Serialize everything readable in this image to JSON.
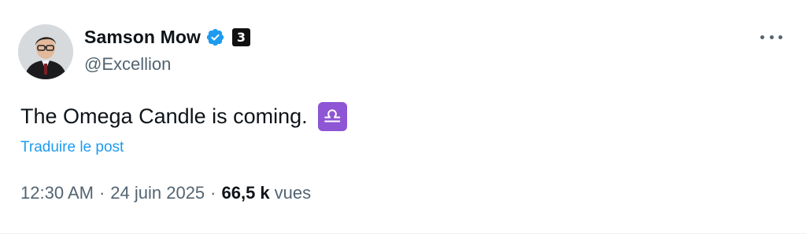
{
  "author": {
    "display_name": "Samson Mow",
    "handle": "@Excellion",
    "verified": true,
    "affiliate_badge": "3"
  },
  "tweet": {
    "text": "The Omega Candle is coming.",
    "emoji": "♎",
    "translate_label": "Traduire le post"
  },
  "meta": {
    "time": "12:30 AM",
    "separator": "·",
    "date": "24 juin 2025",
    "views_count": "66,5 k",
    "views_label": "vues"
  },
  "colors": {
    "text_primary": "#0f1419",
    "text_secondary": "#536471",
    "link": "#1d9bf0",
    "verified": "#1d9bf0",
    "libra_emoji_bg": "#8e55d4"
  },
  "icons": {
    "verified": "verified-badge-icon",
    "more": "more-options-icon",
    "libra": "libra-emoji-icon"
  }
}
